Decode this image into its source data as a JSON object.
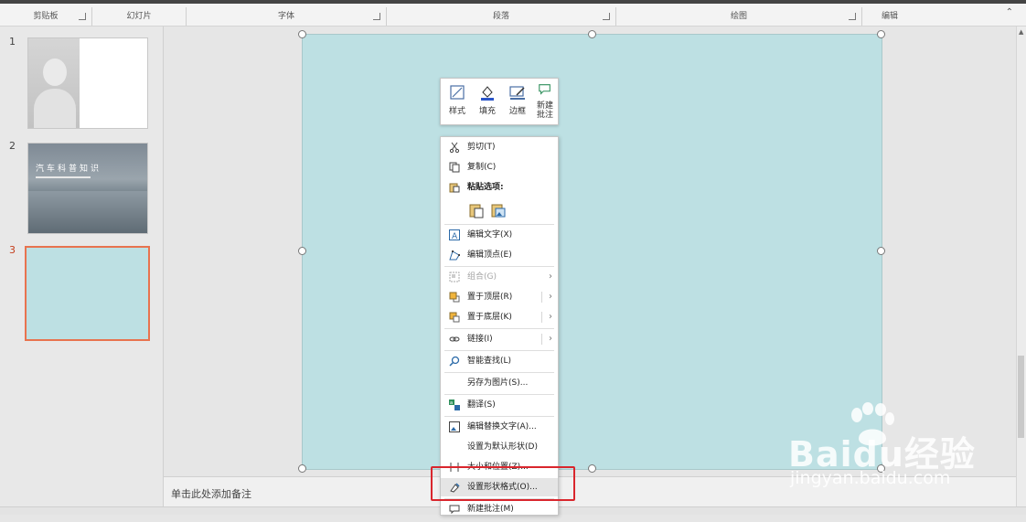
{
  "ribbon": {
    "groups": [
      "剪贴板",
      "幻灯片",
      "字体",
      "段落",
      "绘图",
      "编辑"
    ]
  },
  "thumbnails": {
    "items": [
      {
        "number": "1"
      },
      {
        "number": "2",
        "title": "汽车科普知识"
      },
      {
        "number": "3",
        "active": true
      }
    ]
  },
  "notes": {
    "placeholder": "单击此处添加备注"
  },
  "mini_toolbar": {
    "buttons": [
      {
        "label": "样式",
        "icon": "style-icon"
      },
      {
        "label": "填充",
        "icon": "fill-bucket-icon"
      },
      {
        "label": "边框",
        "icon": "outline-pen-icon"
      },
      {
        "label": "新建\n批注",
        "label_line1": "新建",
        "label_line2": "批注",
        "icon": "new-comment-icon"
      }
    ]
  },
  "context_menu": {
    "cut": "剪切(T)",
    "copy": "复制(C)",
    "paste_options": "粘贴选项:",
    "edit_text": "编辑文字(X)",
    "edit_points": "编辑顶点(E)",
    "group": "组合(G)",
    "bring_to_front": "置于顶层(R)",
    "send_to_back": "置于底层(K)",
    "link": "链接(I)",
    "smart_lookup": "智能查找(L)",
    "save_as_picture": "另存为图片(S)...",
    "translate": "翻译(S)",
    "edit_alt_text": "编辑替换文字(A)...",
    "set_default_shape": "设置为默认形状(D)",
    "size_position": "大小和位置(Z)...",
    "format_shape": "设置形状格式(O)...",
    "new_comment": "新建批注(M)"
  },
  "watermark": {
    "brand": "Baidu经验",
    "url": "jingyan.baidu.com"
  },
  "colors": {
    "slide_fill": "#bde0e3",
    "active_thumb_border": "#e8734f",
    "highlight": "#d9262d"
  }
}
